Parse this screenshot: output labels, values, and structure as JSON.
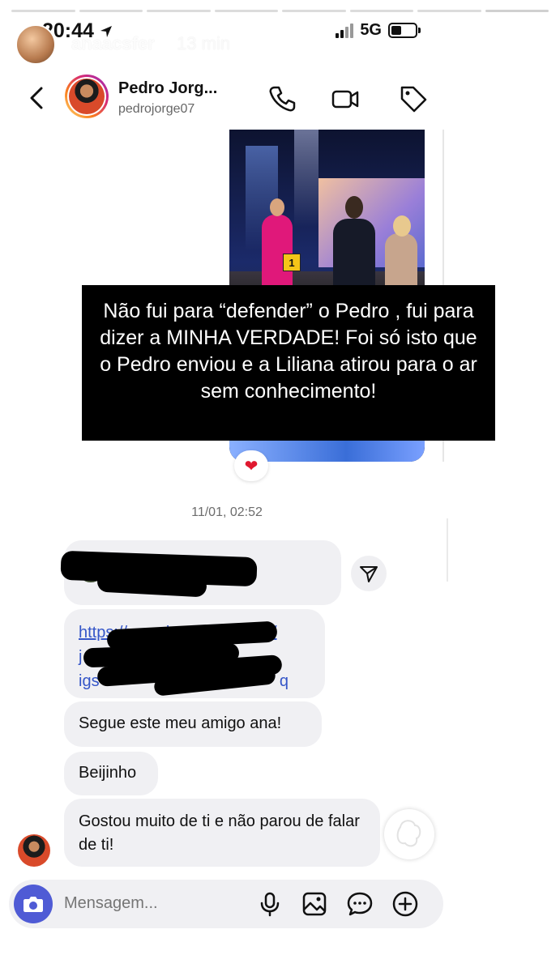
{
  "status_bar": {
    "time": "20:44",
    "network": "5G"
  },
  "story": {
    "username": "anaacsfer",
    "time_ago": "13 min",
    "more": "···",
    "progress_segments": 8,
    "progress_done": 7
  },
  "dm": {
    "name": "Pedro Jorg...",
    "handle": "pedrojorge07"
  },
  "shared_media": {
    "badge": "1"
  },
  "reaction": "❤",
  "caption": "Não fui para “defender” o Pedro , fui para dizer a MINHA VERDADE! Foi só isto que o Pedro enviou e a Liliana atirou para o ar sem conhecimento!",
  "timestamp": "11/01, 02:52",
  "messages": {
    "link_lines": [
      "https://www.instagram.com/",
      "j",
      "igs                                        q"
    ],
    "m3": "Segue este meu amigo ana!",
    "m4": "Beijinho",
    "m5": "Gostou muito de ti e não parou de falar de ti!"
  },
  "composer": {
    "placeholder": "Mensagem..."
  }
}
